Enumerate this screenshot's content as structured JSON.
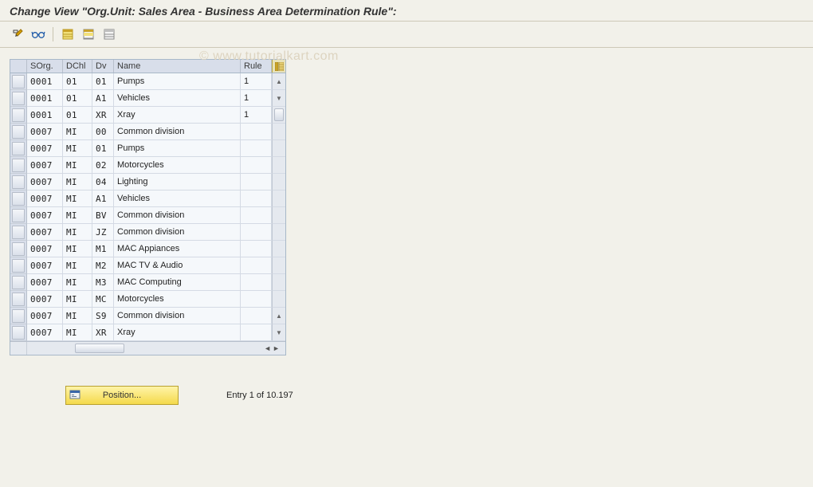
{
  "title": "Change View \"Org.Unit: Sales Area - Business Area Determination Rule\":",
  "watermark": "© www.tutorialkart.com",
  "toolbar": {
    "items": [
      {
        "icon": "display-change",
        "name": "toggle-display-change-icon"
      },
      {
        "icon": "glasses",
        "name": "other-entry-icon"
      },
      {
        "type": "sep"
      },
      {
        "icon": "select-all",
        "name": "select-all-icon"
      },
      {
        "icon": "select-block",
        "name": "select-block-icon"
      },
      {
        "icon": "deselect",
        "name": "deselect-all-icon"
      }
    ]
  },
  "columns": {
    "sel": "",
    "sorg": "SOrg.",
    "dch": "DChl",
    "dv": "Dv",
    "name": "Name",
    "rule": "Rule"
  },
  "rows": [
    {
      "sorg": "0001",
      "dch": "01",
      "dv": "01",
      "name": "Pumps",
      "rule": "1"
    },
    {
      "sorg": "0001",
      "dch": "01",
      "dv": "A1",
      "name": "Vehicles",
      "rule": "1"
    },
    {
      "sorg": "0001",
      "dch": "01",
      "dv": "XR",
      "name": "Xray",
      "rule": "1"
    },
    {
      "sorg": "0007",
      "dch": "MI",
      "dv": "00",
      "name": "Common division",
      "rule": ""
    },
    {
      "sorg": "0007",
      "dch": "MI",
      "dv": "01",
      "name": "Pumps",
      "rule": ""
    },
    {
      "sorg": "0007",
      "dch": "MI",
      "dv": "02",
      "name": "Motorcycles",
      "rule": ""
    },
    {
      "sorg": "0007",
      "dch": "MI",
      "dv": "04",
      "name": "Lighting",
      "rule": ""
    },
    {
      "sorg": "0007",
      "dch": "MI",
      "dv": "A1",
      "name": "Vehicles",
      "rule": ""
    },
    {
      "sorg": "0007",
      "dch": "MI",
      "dv": "BV",
      "name": "Common division",
      "rule": ""
    },
    {
      "sorg": "0007",
      "dch": "MI",
      "dv": "JZ",
      "name": "Common division",
      "rule": ""
    },
    {
      "sorg": "0007",
      "dch": "MI",
      "dv": "M1",
      "name": "MAC Appiances",
      "rule": ""
    },
    {
      "sorg": "0007",
      "dch": "MI",
      "dv": "M2",
      "name": "MAC TV & Audio",
      "rule": ""
    },
    {
      "sorg": "0007",
      "dch": "MI",
      "dv": "M3",
      "name": "MAC Computing",
      "rule": ""
    },
    {
      "sorg": "0007",
      "dch": "MI",
      "dv": "MC",
      "name": "Motorcycles",
      "rule": ""
    },
    {
      "sorg": "0007",
      "dch": "MI",
      "dv": "S9",
      "name": "Common division",
      "rule": ""
    },
    {
      "sorg": "0007",
      "dch": "MI",
      "dv": "XR",
      "name": "Xray",
      "rule": ""
    }
  ],
  "position_button": "Position...",
  "entry_status": "Entry 1 of 10.197"
}
